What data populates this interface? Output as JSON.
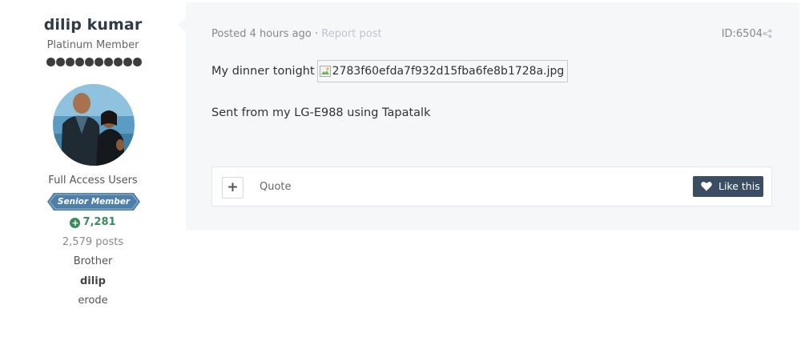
{
  "author": {
    "name": "dilip kumar",
    "title": "Platinum Member",
    "pip_count": 10,
    "group": "Full Access Users",
    "rank_label": "Senior Member",
    "reputation": "7,281",
    "posts": "2,579 posts",
    "field_1": "Brother",
    "field_2": "dilip",
    "field_3": "erode"
  },
  "post": {
    "posted": "Posted 4 hours ago",
    "separator": "·",
    "report_link": "Report post",
    "id_label": "ID:6504",
    "body_line_1": "My dinner tonight",
    "image_name": "2783f60efda7f932d15fba6fe8b1728a.jpg",
    "body_line_2": "Sent from my LG-E988 using Tapatalk"
  },
  "controls": {
    "plus_label": "+",
    "quote_label": "Quote",
    "like_label": "Like this"
  },
  "colors": {
    "post_bg": "#f6f7f9",
    "like_button": "#3a4d63",
    "reputation": "#3b8b5a",
    "rank_badge": "#4e7fa8"
  },
  "icons": {
    "share": "share-icon",
    "heart": "heart-icon",
    "broken_image": "broken-image-icon",
    "reputation_plus": "plus-circle-icon"
  }
}
